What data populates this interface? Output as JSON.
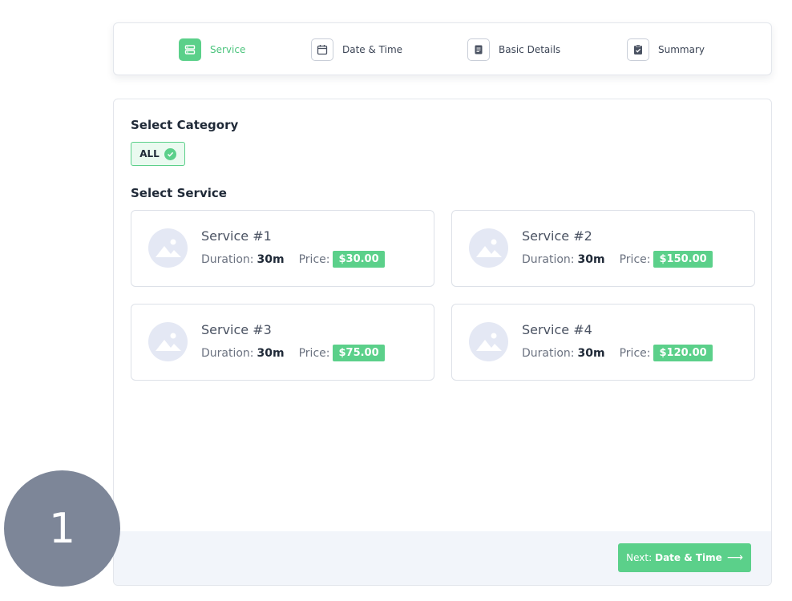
{
  "steps": [
    {
      "label": "Service",
      "icon": "server-icon",
      "active": true
    },
    {
      "label": "Date & Time",
      "icon": "calendar-icon",
      "active": false
    },
    {
      "label": "Basic Details",
      "icon": "document-icon",
      "active": false
    },
    {
      "label": "Summary",
      "icon": "clipboard-check-icon",
      "active": false
    }
  ],
  "category": {
    "title": "Select Category",
    "chip_label": "ALL"
  },
  "service_section": {
    "title": "Select Service",
    "duration_label": "Duration:",
    "price_label": "Price:",
    "services": [
      {
        "name": "Service #1",
        "duration": "30m",
        "price": "$30.00"
      },
      {
        "name": "Service #2",
        "duration": "30m",
        "price": "$150.00"
      },
      {
        "name": "Service #3",
        "duration": "30m",
        "price": "$75.00"
      },
      {
        "name": "Service #4",
        "duration": "30m",
        "price": "$120.00"
      }
    ]
  },
  "footer": {
    "next_prefix": "Next:",
    "next_target": "Date & Time"
  },
  "step_indicator": "1",
  "colors": {
    "accent": "#5bd08a",
    "accent_text": "#4cc47d",
    "badge_bg": "#7d8698",
    "footer_bg": "#f2f5fa"
  }
}
